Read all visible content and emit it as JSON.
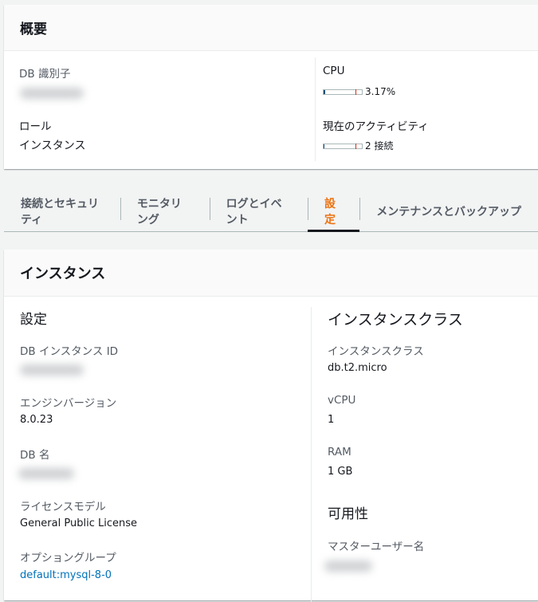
{
  "summary": {
    "title": "概要",
    "db_id_label": "DB 識別子",
    "role_label": "ロール",
    "role_value": "インスタンス",
    "cpu_label": "CPU",
    "cpu_value": "3.17%",
    "cpu_percent": 3.17,
    "activity_label": "現在のアクティビティ",
    "activity_value": "2 接続"
  },
  "tabs": [
    {
      "label": "接続とセキュリティ"
    },
    {
      "label": "モニタリング"
    },
    {
      "label": "ログとイベント"
    },
    {
      "label": "設定",
      "active": true
    },
    {
      "label": "メンテナンスとバックアップ"
    }
  ],
  "instance": {
    "title": "インスタンス",
    "left": {
      "heading": "設定",
      "db_instance_id_label": "DB インスタンス ID",
      "engine_version_label": "エンジンバージョン",
      "engine_version": "8.0.23",
      "db_name_label": "DB 名",
      "license_label": "ライセンスモデル",
      "license": "General Public License",
      "option_group_label": "オプショングループ",
      "option_group": "default:mysql-8-0"
    },
    "right": {
      "heading": "インスタンスクラス",
      "class_label": "インスタンスクラス",
      "class": "db.t2.micro",
      "vcpu_label": "vCPU",
      "vcpu": "1",
      "ram_label": "RAM",
      "ram": "1 GB",
      "availability_heading": "可用性",
      "master_user_label": "マスターユーザー名"
    }
  },
  "colors": {
    "accent": "#ec7211",
    "link": "#0073bb"
  }
}
